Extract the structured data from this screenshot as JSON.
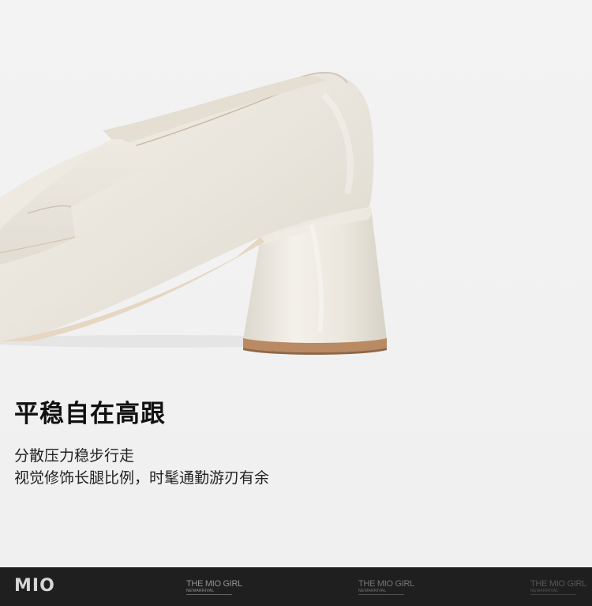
{
  "headline": "平稳自在高跟",
  "description": {
    "line1": "分散压力稳步行走",
    "line2": "视觉修饰长腿比例，时髦通勤游刃有余"
  },
  "footer": {
    "brand": "MIO",
    "tagline_main": "THE MIO GIRL",
    "tagline_sub": "NEWARRIVAL"
  },
  "product": {
    "image_name": "white-patent-loafer-heel-icon",
    "color": "#ebe7df"
  }
}
